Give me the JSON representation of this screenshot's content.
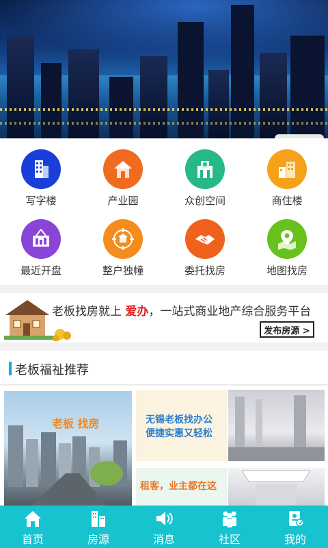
{
  "categories": [
    {
      "label": "写字楼",
      "icon": "office-building-icon",
      "color": "#1a3fd8"
    },
    {
      "label": "产业园",
      "icon": "industrial-house-icon",
      "color": "#ef6b1f"
    },
    {
      "label": "众创空间",
      "icon": "coworking-space-icon",
      "color": "#27b88a"
    },
    {
      "label": "商住楼",
      "icon": "commercial-residential-icon",
      "color": "#f6a11a"
    },
    {
      "label": "最近开盘",
      "icon": "new-opening-sign-icon",
      "color": "#8a45d8"
    },
    {
      "label": "整户独幢",
      "icon": "whole-building-target-icon",
      "color": "#f58d1e"
    },
    {
      "label": "委托找房",
      "icon": "handshake-icon",
      "color": "#f0621b"
    },
    {
      "label": "地图找房",
      "icon": "map-pin-icon",
      "color": "#67c21c"
    }
  ],
  "promo": {
    "text_prefix": "老板找房就上 ",
    "brand": "爱办",
    "text_suffix": "，一站式商业地产综合服务平台",
    "button_label": "发布房源 >"
  },
  "section": {
    "title": "老板福祉推荐"
  },
  "recommend": {
    "card_a_caption": "老板 找房",
    "card_b_line1": "无锡老板找办公",
    "card_b_line2": "便捷实惠又轻松",
    "card_d_caption": "租客，业主都在这"
  },
  "tabbar": [
    {
      "label": "首页",
      "icon": "home-icon"
    },
    {
      "label": "房源",
      "icon": "buildings-icon"
    },
    {
      "label": "消息",
      "icon": "speaker-icon"
    },
    {
      "label": "社区",
      "icon": "community-people-icon"
    },
    {
      "label": "我的",
      "icon": "profile-document-icon"
    }
  ],
  "colors": {
    "accent": "#16c3cf",
    "section_bar": "#1aa7e1",
    "brand_red": "#e31b1b"
  }
}
